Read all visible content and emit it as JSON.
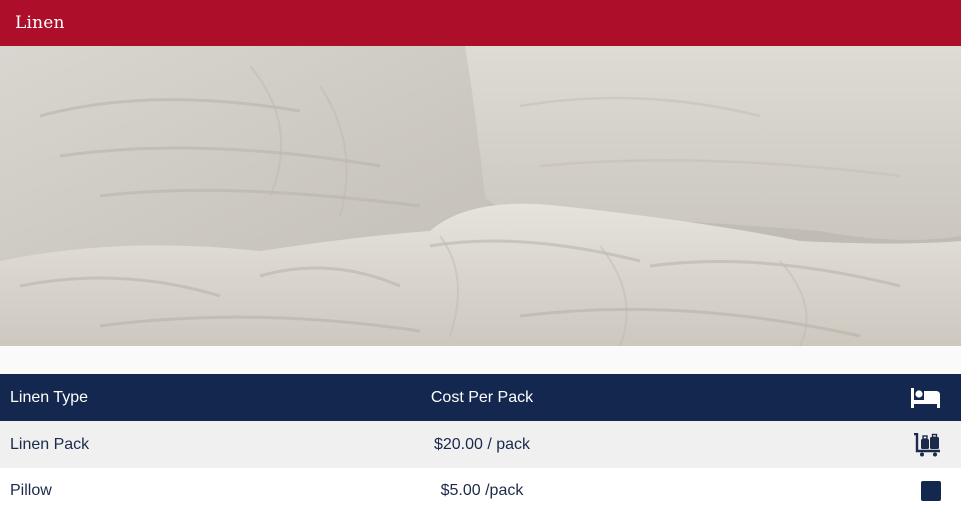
{
  "header": {
    "title": "Linen"
  },
  "hero": {
    "image": "unmade-bed-white-linen-photo"
  },
  "table": {
    "columns": {
      "type": "Linen Type",
      "cost": "Cost Per Pack",
      "icon": "bed-icon"
    },
    "rows": [
      {
        "type": "Linen Pack",
        "cost": "$20.00 / pack",
        "icon": "luggage-cart-icon"
      },
      {
        "type": "Pillow",
        "cost": "$5.00 /pack",
        "icon": "square-icon"
      }
    ]
  },
  "colors": {
    "header_bg": "#ad0e2a",
    "table_head_bg": "#14274e",
    "text_dark": "#1b2a4a",
    "row_alt_bg": "#f0f0f0"
  }
}
